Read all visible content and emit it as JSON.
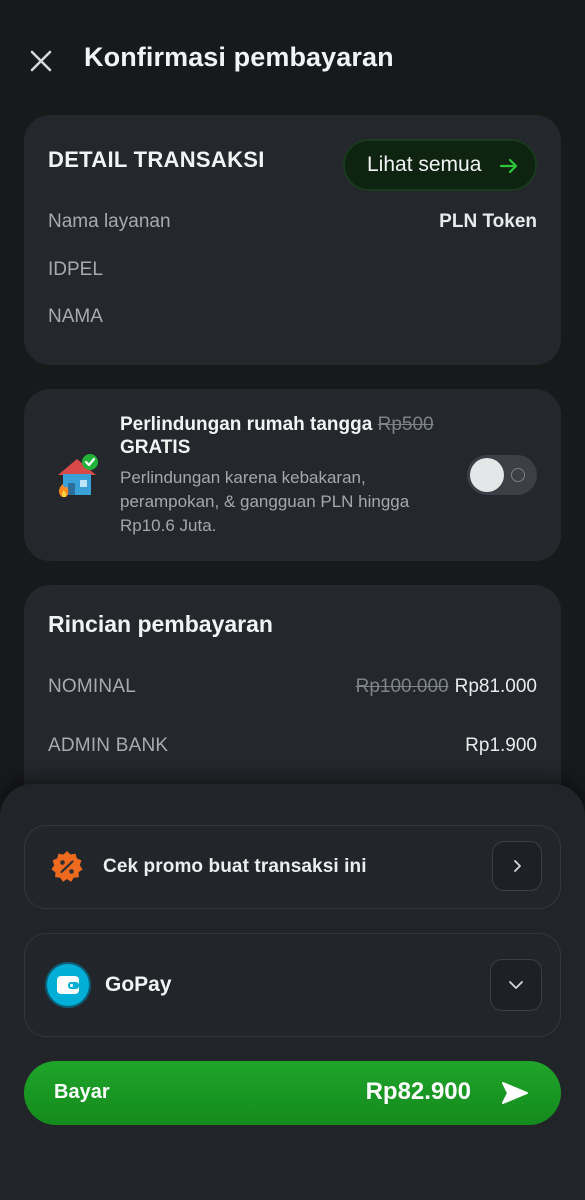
{
  "header": {
    "title": "Konfirmasi pembayaran"
  },
  "transaction": {
    "title": "DETAIL TRANSAKSI",
    "see_all_label": "Lihat semua",
    "rows": [
      {
        "label": "Nama layanan",
        "value": "PLN Token"
      },
      {
        "label": "IDPEL",
        "value": ""
      },
      {
        "label": "NAMA",
        "value": ""
      }
    ]
  },
  "protection": {
    "title": "Perlindungan rumah tangga",
    "old_price": "Rp500",
    "free_label": "GRATIS",
    "description": "Perlindungan karena kebakaran, perampokan, & gangguan PLN hingga Rp10.6 Juta.",
    "toggle_on": false
  },
  "payment_details": {
    "title": "Rincian pembayaran",
    "rows": [
      {
        "label": "NOMINAL",
        "old_value": "Rp100.000",
        "value": "Rp81.000"
      },
      {
        "label": "ADMIN BANK",
        "old_value": "",
        "value": "Rp1.900"
      }
    ]
  },
  "promo": {
    "label": "Cek promo buat transaksi ini"
  },
  "payment_method": {
    "name": "GoPay"
  },
  "pay_button": {
    "label": "Bayar",
    "total": "Rp82.900"
  },
  "colors": {
    "background": "#18191b",
    "card": "#24282c",
    "accent_green": "#1fa52a",
    "promo_orange": "#ee6a1f",
    "gopay_blue": "#00aed6"
  }
}
